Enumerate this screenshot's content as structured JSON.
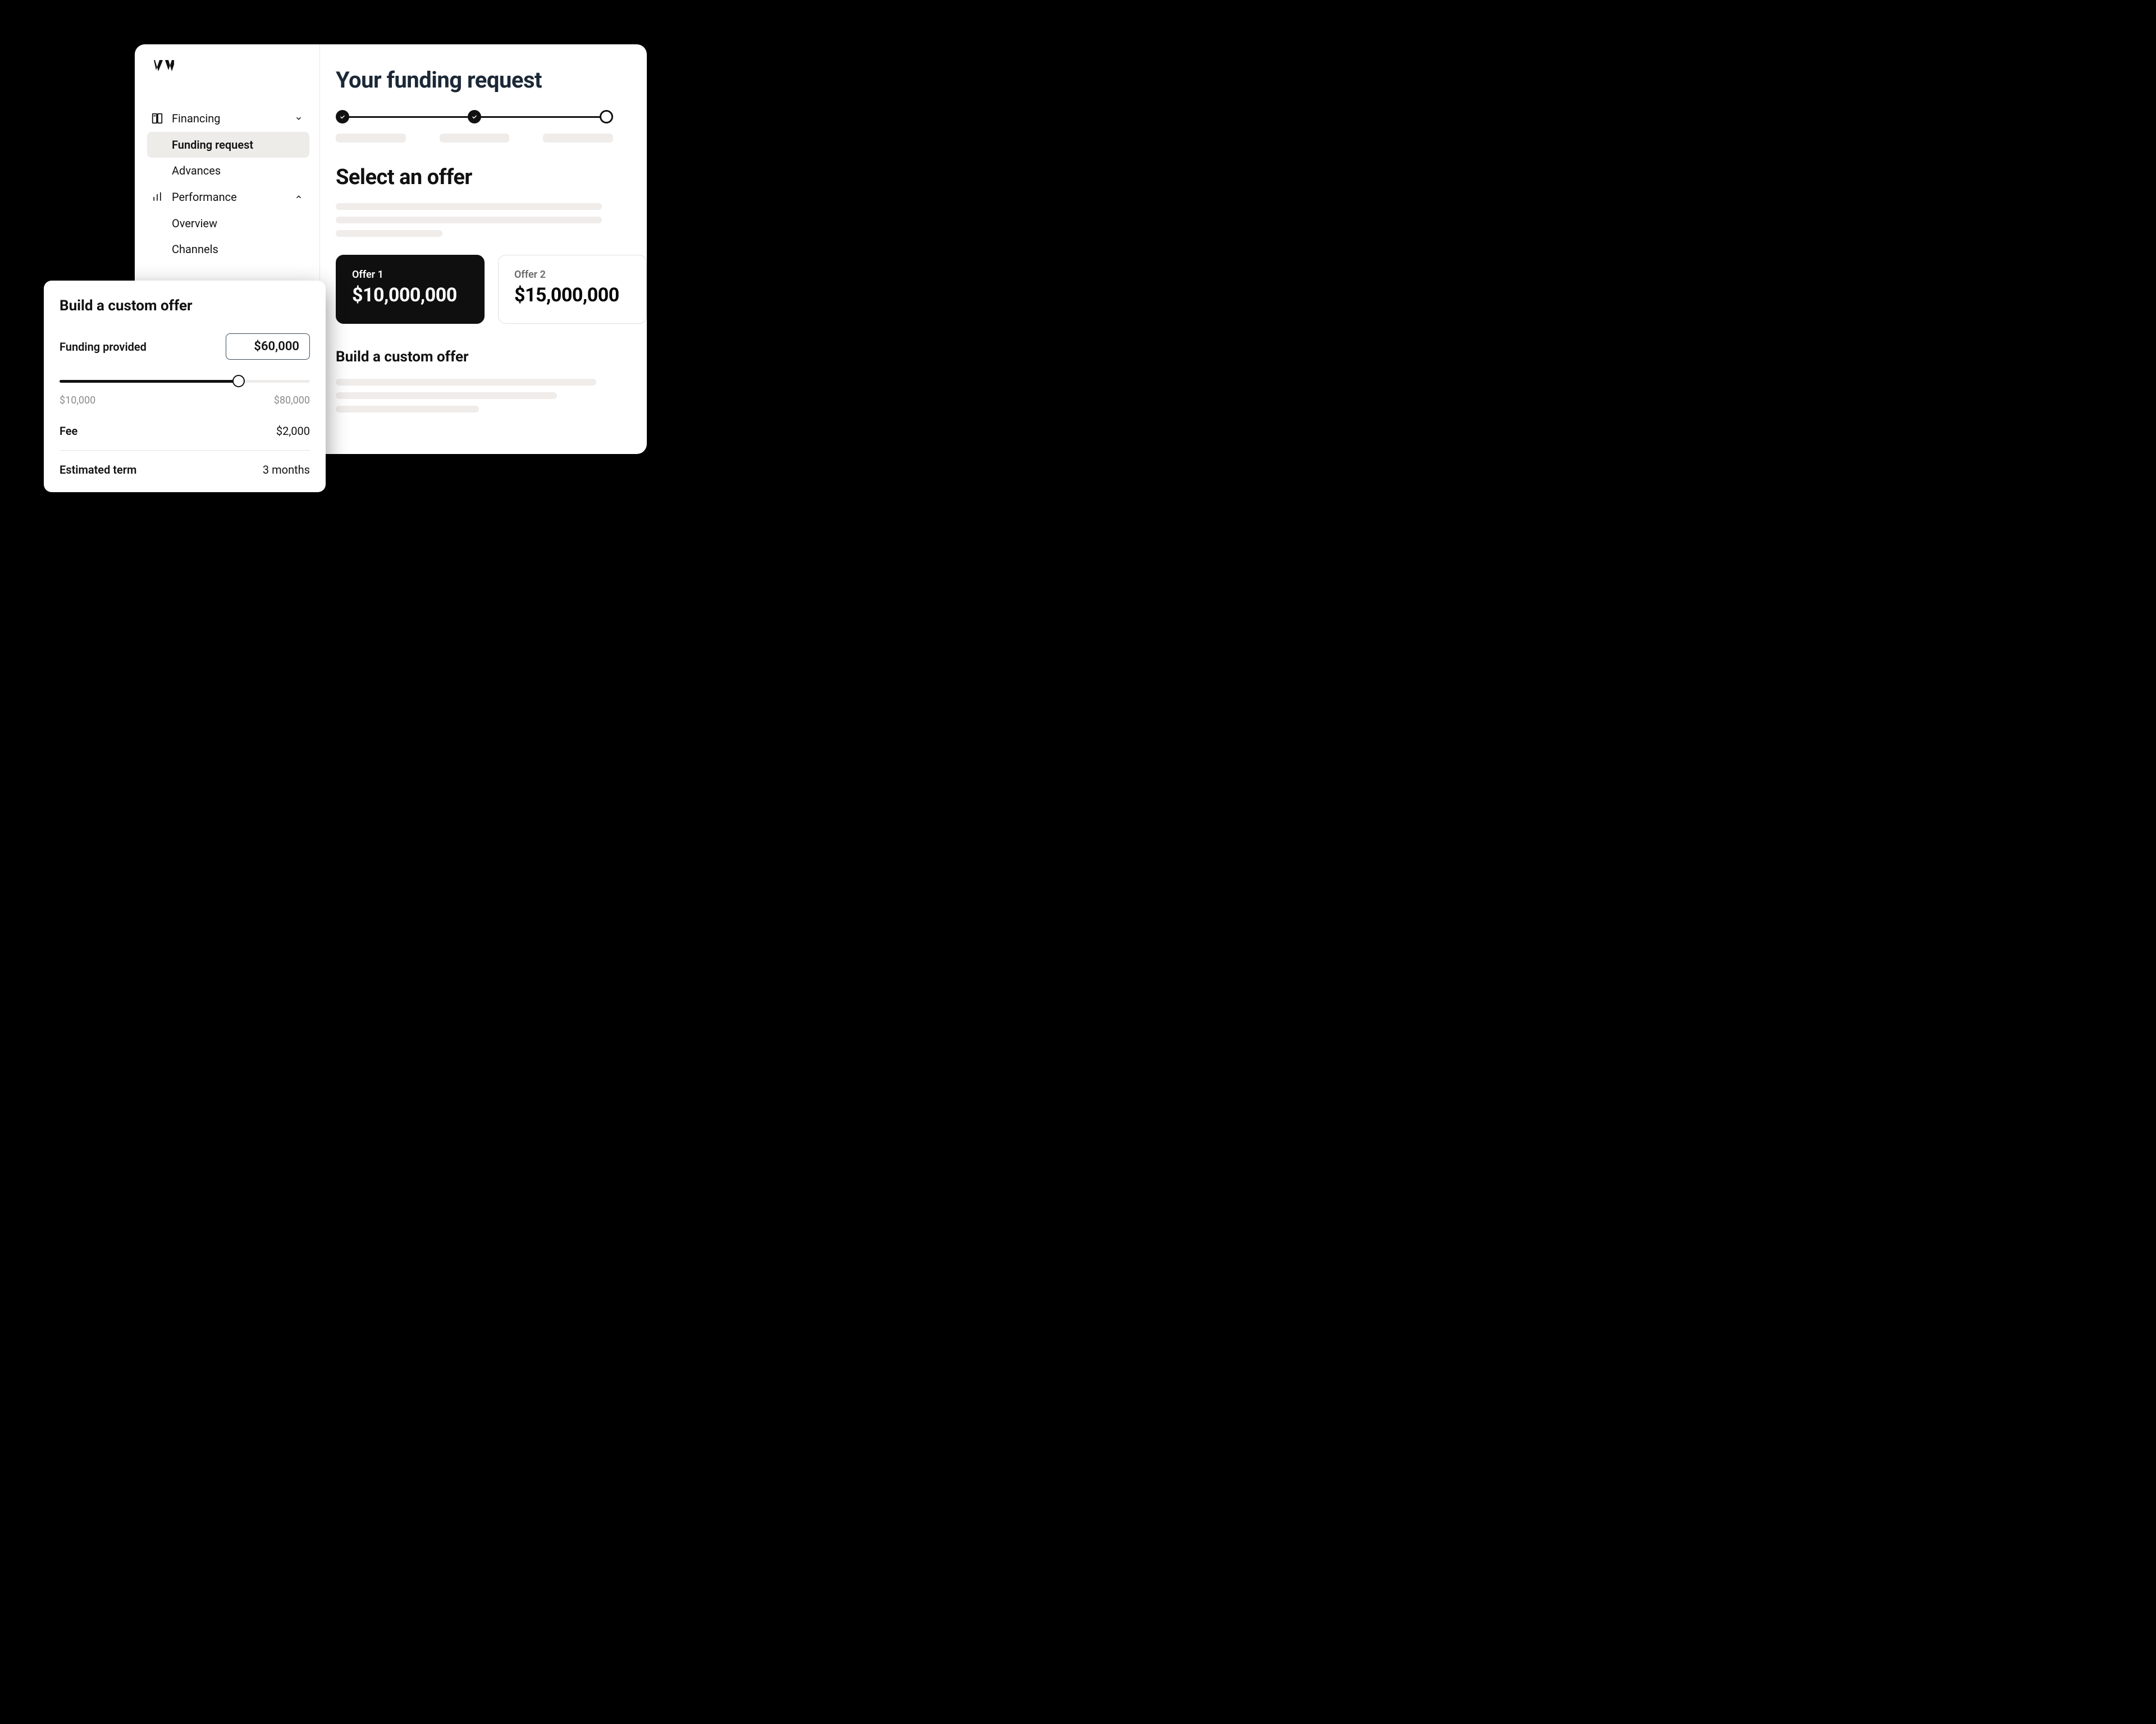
{
  "sidebar": {
    "groups": [
      {
        "label": "Financing",
        "expanded": true,
        "items": [
          {
            "label": "Funding request",
            "active": true
          },
          {
            "label": "Advances",
            "active": false
          }
        ]
      },
      {
        "label": "Performance",
        "expanded": true,
        "items": [
          {
            "label": "Overview",
            "active": false
          },
          {
            "label": "Channels",
            "active": false
          }
        ]
      }
    ]
  },
  "main": {
    "title": "Your funding request",
    "stepper": {
      "total": 3,
      "completed": 2
    },
    "select_offer_title": "Select an offer",
    "offers": [
      {
        "label": "Offer 1",
        "amount": "$10,000,000",
        "selected": true
      },
      {
        "label": "Offer 2",
        "amount": "$15,000,000",
        "selected": false
      }
    ],
    "custom_offer_title": "Build a custom offer"
  },
  "custom_card": {
    "title": "Build a custom offer",
    "funding_label": "Funding provided",
    "funding_value": "$60,000",
    "slider": {
      "min_label": "$10,000",
      "max_label": "$80,000",
      "min": 10000,
      "max": 80000,
      "value": 60000
    },
    "rows": [
      {
        "k": "Fee",
        "v": "$2,000"
      },
      {
        "k": "Estimated term",
        "v": "3 months"
      }
    ]
  }
}
